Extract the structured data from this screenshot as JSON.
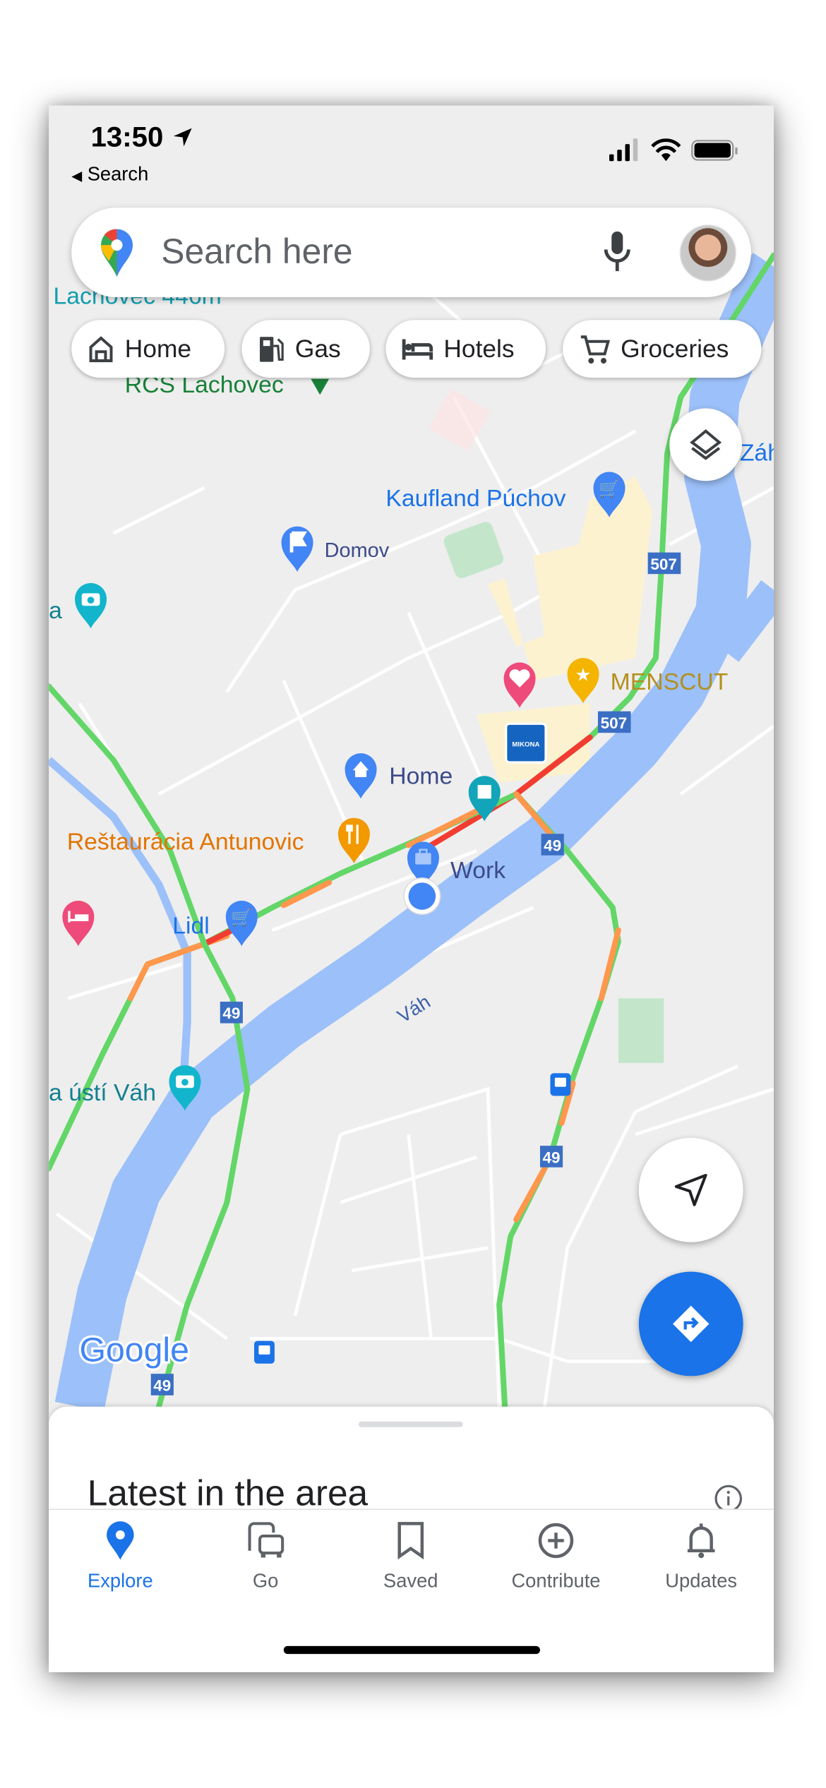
{
  "status_bar": {
    "time": "13:50",
    "back_label": "Search"
  },
  "search": {
    "placeholder": "Search here"
  },
  "chips": [
    {
      "label": "Home",
      "icon": "home-icon"
    },
    {
      "label": "Gas",
      "icon": "gas-station-icon"
    },
    {
      "label": "Hotels",
      "icon": "bed-icon"
    },
    {
      "label": "Groceries",
      "icon": "cart-icon"
    }
  ],
  "map": {
    "labels": {
      "lachovec": "Lachovec 446m",
      "rcs": "RCS Lachovec",
      "kaufland": "Kaufland Púchov",
      "domov": "Domov",
      "menscut": "MENSCUT",
      "mikona": "MIKONA",
      "home": "Home",
      "restaurant": "Reštaurácia Antunovic",
      "work": "Work",
      "lidl": "Lidl",
      "river": "Váh",
      "usti": "a ústí Váh",
      "left_a": "a",
      "zah": "Záh",
      "google": "Google"
    },
    "road_shields": [
      "507",
      "507",
      "49",
      "49",
      "49",
      "49"
    ],
    "colors": {
      "traffic_green": "#63d668",
      "traffic_orange": "#ff974d",
      "traffic_red": "#f23c32",
      "water": "#9cc0f9",
      "accent": "#1a73e8"
    }
  },
  "sheet": {
    "title": "Latest in the area"
  },
  "nav": [
    {
      "label": "Explore",
      "icon": "explore-pin-icon",
      "active": true
    },
    {
      "label": "Go",
      "icon": "commute-icon"
    },
    {
      "label": "Saved",
      "icon": "bookmark-icon"
    },
    {
      "label": "Contribute",
      "icon": "add-circle-icon"
    },
    {
      "label": "Updates",
      "icon": "bell-icon"
    }
  ]
}
